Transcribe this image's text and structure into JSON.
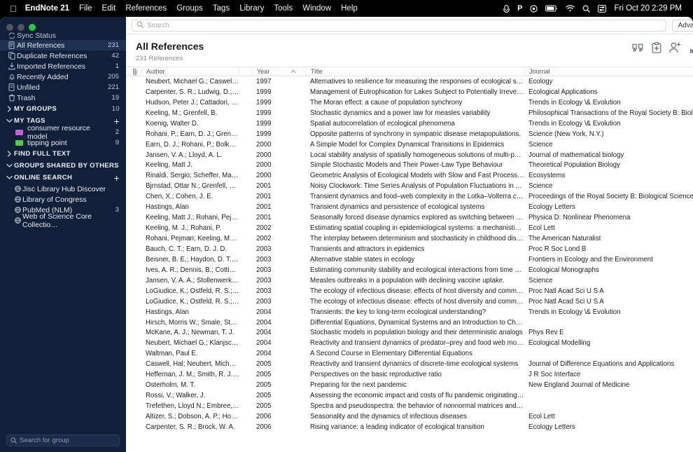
{
  "menubar": {
    "apple": "apple-logo",
    "app_name": "EndNote 21",
    "items": [
      "File",
      "Edit",
      "References",
      "Groups",
      "Tags",
      "Library",
      "Tools",
      "Window",
      "Help"
    ],
    "status_icons": [
      "keyboard-input-icon",
      "parsec-p-icon",
      "record-icon",
      "battery-icon",
      "wifi-icon",
      "search-icon",
      "control-center-icon"
    ],
    "clock": "Fri Oct 20  2:29 PM"
  },
  "window": {
    "traffic_lights": [
      "close-button",
      "minimize-button",
      "zoom-button"
    ]
  },
  "sidebar": {
    "partial_top": {
      "label": "Sync Status",
      "icon": "sync-icon"
    },
    "library_items": [
      {
        "label": "All References",
        "count": "231",
        "icon": "library-icon",
        "selected": true
      },
      {
        "label": "Duplicate References",
        "count": "42",
        "icon": "duplicate-icon",
        "selected": false
      },
      {
        "label": "Imported References",
        "count": "1",
        "icon": "import-icon",
        "selected": false
      },
      {
        "label": "Recently Added",
        "count": "205",
        "icon": "bell-icon",
        "selected": false
      },
      {
        "label": "Unfiled",
        "count": "221",
        "icon": "unfiled-icon",
        "selected": false
      },
      {
        "label": "Trash",
        "count": "19",
        "icon": "trash-icon",
        "selected": false
      }
    ],
    "my_groups": {
      "label": "MY GROUPS",
      "count": "10",
      "expanded": false
    },
    "my_tags": {
      "label": "MY TAGS",
      "expanded": true,
      "add": "+"
    },
    "tags": [
      {
        "label": "consumer resource model",
        "count": "2",
        "color": "#c162d6"
      },
      {
        "label": "tipping point",
        "count": "9",
        "color": "#52cc4a"
      }
    ],
    "find_full_text": {
      "label": "FIND FULL TEXT",
      "expanded": false
    },
    "groups_shared": {
      "label": "GROUPS SHARED BY OTHERS",
      "expanded": true
    },
    "online_search": {
      "label": "ONLINE SEARCH",
      "expanded": true,
      "add": "+"
    },
    "online_sources": [
      {
        "label": "Jisc Library Hub Discover",
        "count": "",
        "icon": "globe-icon"
      },
      {
        "label": "Library of Congress",
        "count": "",
        "icon": "globe-icon"
      },
      {
        "label": "PubMed (NLM)",
        "count": "3",
        "icon": "globe-icon"
      },
      {
        "label": "Web of Science Core Collectio…",
        "count": "",
        "icon": "globe-icon"
      }
    ],
    "group_search_placeholder": "Search for group"
  },
  "search": {
    "placeholder": "Search",
    "value": "",
    "icon": "search-icon",
    "advanced_label": "Advanced Search"
  },
  "header": {
    "title": "All References",
    "subtitle": "231 References",
    "tools": [
      "quote-cite-icon",
      "clipboard-plus-icon",
      "add-person-icon",
      "share-export-icon",
      "find-full-text-icon",
      "online-search-globe-icon"
    ]
  },
  "table": {
    "columns": {
      "attachment": "attachment-icon",
      "author": "Author",
      "year": "Year",
      "sort_indicator": "sort-ascending-icon",
      "title": "Title",
      "journal": "Journal"
    },
    "rows": [
      {
        "author": "Neubert, Michael G.; Caswell,…",
        "year": "1997",
        "title": "Alternatives to resilience for measuring the responses of ecological systems…",
        "journal": "Ecology"
      },
      {
        "author": "Carpenter, S. R.; Ludwig, D.; Br…",
        "year": "1999",
        "title": "Management of Eutrophication for Lakes Subject to Potentially Irreversible C…",
        "journal": "Ecological Applications"
      },
      {
        "author": "Hudson, Peter J.; Cattadori, Isa…",
        "year": "1999",
        "title": "The Moran effect: a cause of population synchrony",
        "journal": "Trends in Ecology \\& Evolution"
      },
      {
        "author": "Keeling, M.; Grenfell, B.",
        "year": "1999",
        "title": "Stochastic dynamics and a power law for measles variability",
        "journal": "Philosophical Transactions of the Royal Society B: Biological Sciences"
      },
      {
        "author": "Koenig, Walter D.",
        "year": "1999",
        "title": "Spatial autocorrelation of ecological phenomena",
        "journal": "Trends in Ecology \\& Evolution"
      },
      {
        "author": "Rohani, P.; Earn, D. J.; Grenfell,…",
        "year": "1999",
        "title": "Opposite patterns of synchrony in sympatric disease metapopulations.",
        "journal": "Science (New York, N.Y.)"
      },
      {
        "author": "Earn, D. J.; Rohani, P.; Bolker, B…",
        "year": "2000",
        "title": "A Simple Model for Complex Dynamical Transitions in Epidemics",
        "journal": "Science"
      },
      {
        "author": "Jansen, V. A.; Lloyd, A. L.",
        "year": "2000",
        "title": "Local stability analysis of spatially homogeneous solutions of multi-patch sy…",
        "journal": "Journal of mathematical biology"
      },
      {
        "author": "Keeling, Matt J.",
        "year": "2000",
        "title": "Simple Stochastic Models and Their Power-Law Type Behaviour",
        "journal": "Theoretical Population Biology"
      },
      {
        "author": "Rinaldi, Sergio; Scheffer, Marten",
        "year": "2000",
        "title": "Geometric Analysis of Ecological Models with Slow and Fast Processes",
        "journal": "Ecosystems"
      },
      {
        "author": "Bjrnstad, Ottar N.; Grenfell, Bry…",
        "year": "2001",
        "title": "Noisy Clockwork: Time Series Analysis of Population Fluctuations in Animals",
        "journal": "Science"
      },
      {
        "author": "Chen, X.; Cohen, J. E.",
        "year": "2001",
        "title": "Transient dynamics and food–web complexity in the Lotka–Volterra cascade…",
        "journal": "Proceedings of the Royal Society B: Biological Sciences"
      },
      {
        "author": "Hastings, Alan",
        "year": "2001",
        "title": "Transient dynamics and persistence of ecological systems",
        "journal": "Ecology Letters"
      },
      {
        "author": "Keeling, Matt J.; Rohani, Pejma…",
        "year": "2001",
        "title": "Seasonally forced disease dynamics explored as switching between attractors",
        "journal": "Physica D: Nonlinear Phenomena"
      },
      {
        "author": "Keeling, M. J.; Rohani, P.",
        "year": "2002",
        "title": "Estimating spatial coupling in epidemiological systems: a mechanistic appro…",
        "journal": "Ecol Lett"
      },
      {
        "author": "Rohani, Pejman; Keeling, Matth…",
        "year": "2002",
        "title": "The interplay between determinism and stochasticity in childhood diseases.",
        "journal": "The American Naturalist"
      },
      {
        "author": "Bauch, C. T.; Earn, D. J. D.",
        "year": "2003",
        "title": "Transients and attractors in epidemics",
        "journal": "Proc R Soc Lond B"
      },
      {
        "author": "Beisner, B. E.; Haydon, D. T.; C…",
        "year": "2003",
        "title": "Alternative stable states in ecology",
        "journal": "Frontiers in Ecology and the Environment"
      },
      {
        "author": "Ives, A. R.; Dennis, B.; Cottingh…",
        "year": "2003",
        "title": "Estimating community stability and ecological interactions from time series…",
        "journal": "Ecological Monographs"
      },
      {
        "author": "Jansen, V. A. A.; Stollenwerk, N…",
        "year": "2003",
        "title": "Measles outbreaks in a population with declining vaccine uptake.",
        "journal": "Science"
      },
      {
        "author": "LoGiudice, K.; Ostfeld, R. S.; Sc…",
        "year": "2003",
        "title": "The ecology of infectious disease: effects of host diversity and community c…",
        "journal": "Proc Natl Acad Sci U S A"
      },
      {
        "author": "LoGiudice, K.; Ostfeld, R. S.; Sc…",
        "year": "2003",
        "title": "The ecology of infectious disease: effects of host diversity and community c…",
        "journal": "Proc Natl Acad Sci U S A"
      },
      {
        "author": "Hastings, Alan",
        "year": "2004",
        "title": "Transients: the key to long-term ecological understanding?",
        "journal": "Trends in Ecology \\& Evolution"
      },
      {
        "author": "Hirsch, Morris W.; Smale, Step…",
        "year": "2004",
        "title": "Differential Equations, Dynamical Systems and an Introduction to Chaos",
        "journal": ""
      },
      {
        "author": "McKane, A. J.; Newman, T. J.",
        "year": "2004",
        "title": "Stochastic models in population biology and their deterministic analogs",
        "journal": "Phys Rev E"
      },
      {
        "author": "Neubert, Michael G.; Klanjscek,…",
        "year": "2004",
        "title": "Reactivity and transient dynamics of predator–prey and food web models",
        "journal": "Ecological Modelling"
      },
      {
        "author": "Waltman, Paul E.",
        "year": "2004",
        "title": "A Second Course in Elementary Differential Equations",
        "journal": ""
      },
      {
        "author": "Caswell, Hal; Neubert, Michael…",
        "year": "2005",
        "title": "Reactivity and transient dynamics of discrete-time ecological systems",
        "journal": "Journal of Difference Equations and Applications"
      },
      {
        "author": "Heffernan, J. M.; Smith, R. J.;…",
        "year": "2005",
        "title": "Perspectives on the basic reproductive ratio",
        "journal": "J R Soc Interface"
      },
      {
        "author": "Osterholm, M. T.",
        "year": "2005",
        "title": "Preparing for the next pandemic",
        "journal": "New England Journal of Medicine"
      },
      {
        "author": "Rossi, V.; Walker, J.",
        "year": "2005",
        "title": "Assessing the economic impact and costs of flu pandemic originating in Asia",
        "journal": ""
      },
      {
        "author": "Trefethen, Lloyd N.; Embree, M…",
        "year": "2005",
        "title": "Spectra and pseudospectra: the behavior of nonnormal matrices and operat…",
        "journal": ""
      },
      {
        "author": "Altizer, S.; Dobson, A. P.; Hoss…",
        "year": "2006",
        "title": "Seasonality and the dynamics of infectious diseases",
        "journal": "Ecol Lett"
      },
      {
        "author": "Carpenter, S. R.; Brock, W. A.",
        "year": "2006",
        "title": "Rising variance: a leading indicator of ecological transition",
        "journal": "Ecology Letters"
      }
    ]
  },
  "colors": {
    "sidebar_bg": "#111f39",
    "sidebar_selected": "#1f3152",
    "accent_green": "#28c840",
    "tool_icon": "#5a6b7a"
  }
}
